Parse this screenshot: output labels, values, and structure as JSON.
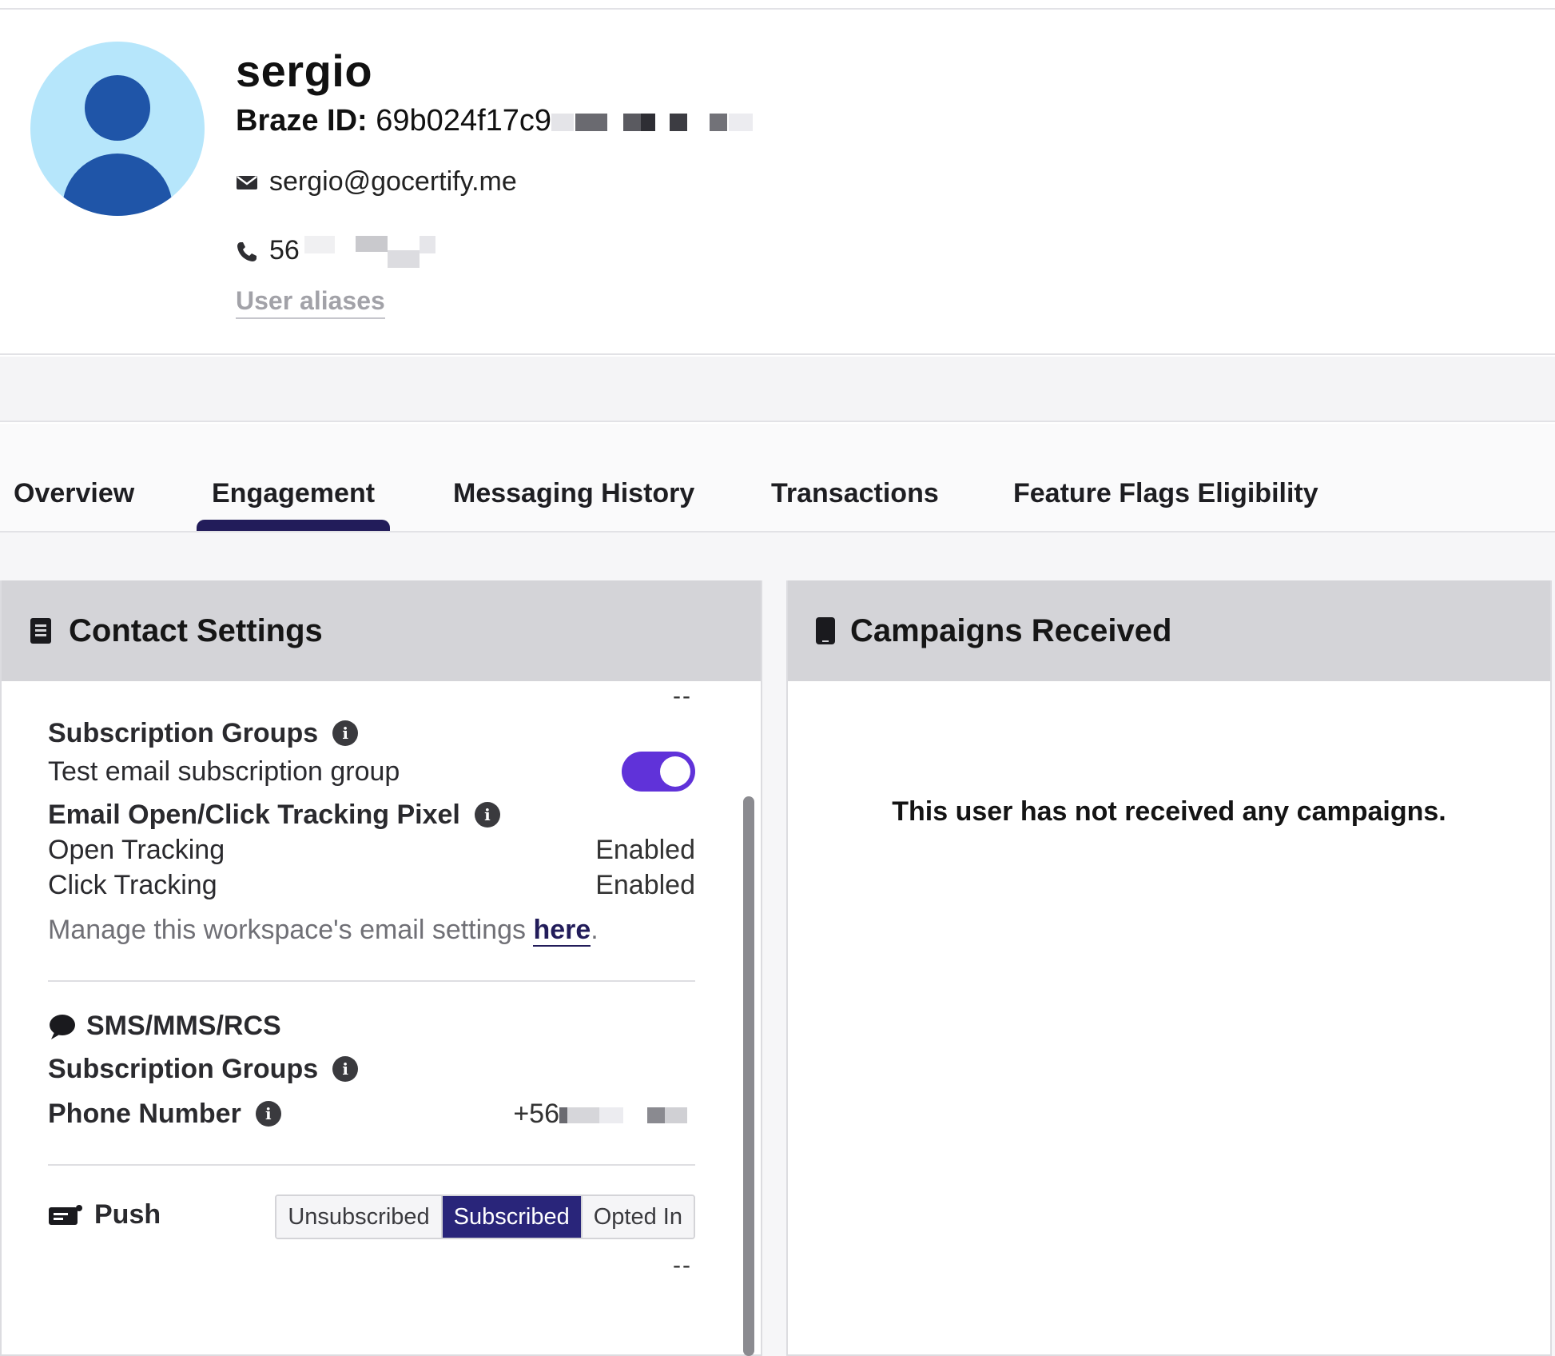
{
  "profile": {
    "name": "sergio",
    "braze_id_label": "Braze ID:",
    "braze_id_value": "69b024f17c9",
    "email": "sergio@gocertify.me",
    "phone": "56",
    "aliases_link": "User aliases"
  },
  "tabs": [
    {
      "label": "Overview"
    },
    {
      "label": "Engagement",
      "active": true
    },
    {
      "label": "Messaging History"
    },
    {
      "label": "Transactions"
    },
    {
      "label": "Feature Flags Eligibility"
    }
  ],
  "contact_settings": {
    "title": "Contact Settings",
    "top_value": "--",
    "email": {
      "subscription_groups_label": "Subscription Groups",
      "group_name": "Test email subscription group",
      "group_subscribed": true,
      "tracking_pixel_label": "Email Open/Click Tracking Pixel",
      "open_tracking_label": "Open Tracking",
      "open_tracking_value": "Enabled",
      "click_tracking_label": "Click Tracking",
      "click_tracking_value": "Enabled",
      "manage_text": "Manage this workspace's email settings ",
      "manage_link": "here",
      "manage_suffix": "."
    },
    "sms": {
      "title": "SMS/MMS/RCS",
      "subscription_groups_label": "Subscription Groups",
      "phone_label": "Phone Number",
      "phone_value": "+56"
    },
    "push": {
      "title": "Push",
      "options": [
        "Unsubscribed",
        "Subscribed",
        "Opted In"
      ],
      "selected": "Subscribed",
      "bottom_value": "--"
    }
  },
  "campaigns": {
    "title": "Campaigns Received",
    "empty_message": "This user has not received any campaigns."
  },
  "colors": {
    "accent": "#221c5a",
    "toggle_on": "#6032d9",
    "segment_active": "#29257a",
    "avatar_bg": "#b6e6fb",
    "avatar_fg": "#1f55a8"
  }
}
